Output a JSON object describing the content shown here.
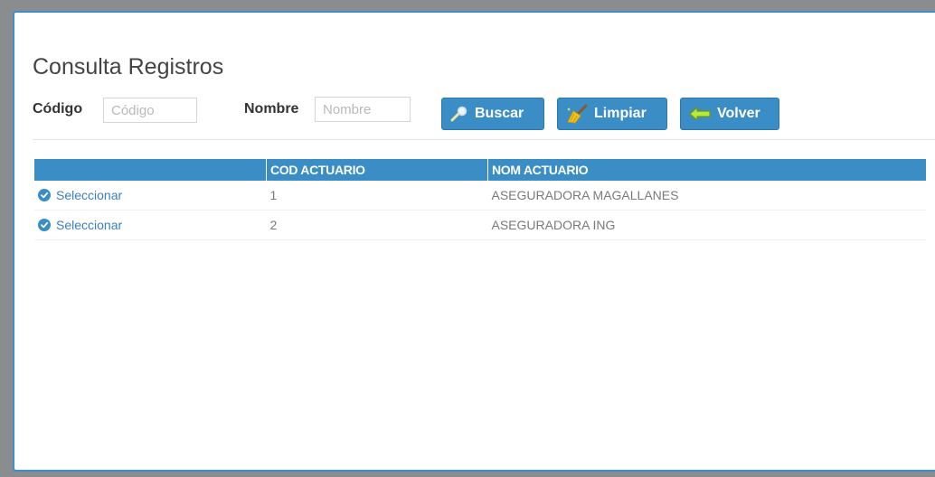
{
  "page": {
    "title": "Consulta Registros"
  },
  "filters": {
    "codigo": {
      "label": "Código",
      "placeholder": "Código",
      "value": ""
    },
    "nombre": {
      "label": "Nombre",
      "placeholder": "Nombre",
      "value": ""
    }
  },
  "buttons": {
    "buscar": "Buscar",
    "limpiar": "Limpiar",
    "volver": "Volver"
  },
  "table": {
    "headers": [
      "",
      "COD ACTUARIO",
      "NOM ACTUARIO"
    ],
    "rows": [
      {
        "action": "Seleccionar",
        "cod": "1",
        "nom": "ASEGURADORA MAGALLANES"
      },
      {
        "action": "Seleccionar",
        "cod": "2",
        "nom": "ASEGURADORA ING"
      }
    ]
  },
  "colors": {
    "accent": "#3a8dc5",
    "border": "#3e8fc7",
    "background": "#8a8d90"
  },
  "icons": {
    "buscar": "search-icon",
    "limpiar": "broom-icon",
    "volver": "back-arrow-icon",
    "seleccionar": "check-circle-icon"
  }
}
